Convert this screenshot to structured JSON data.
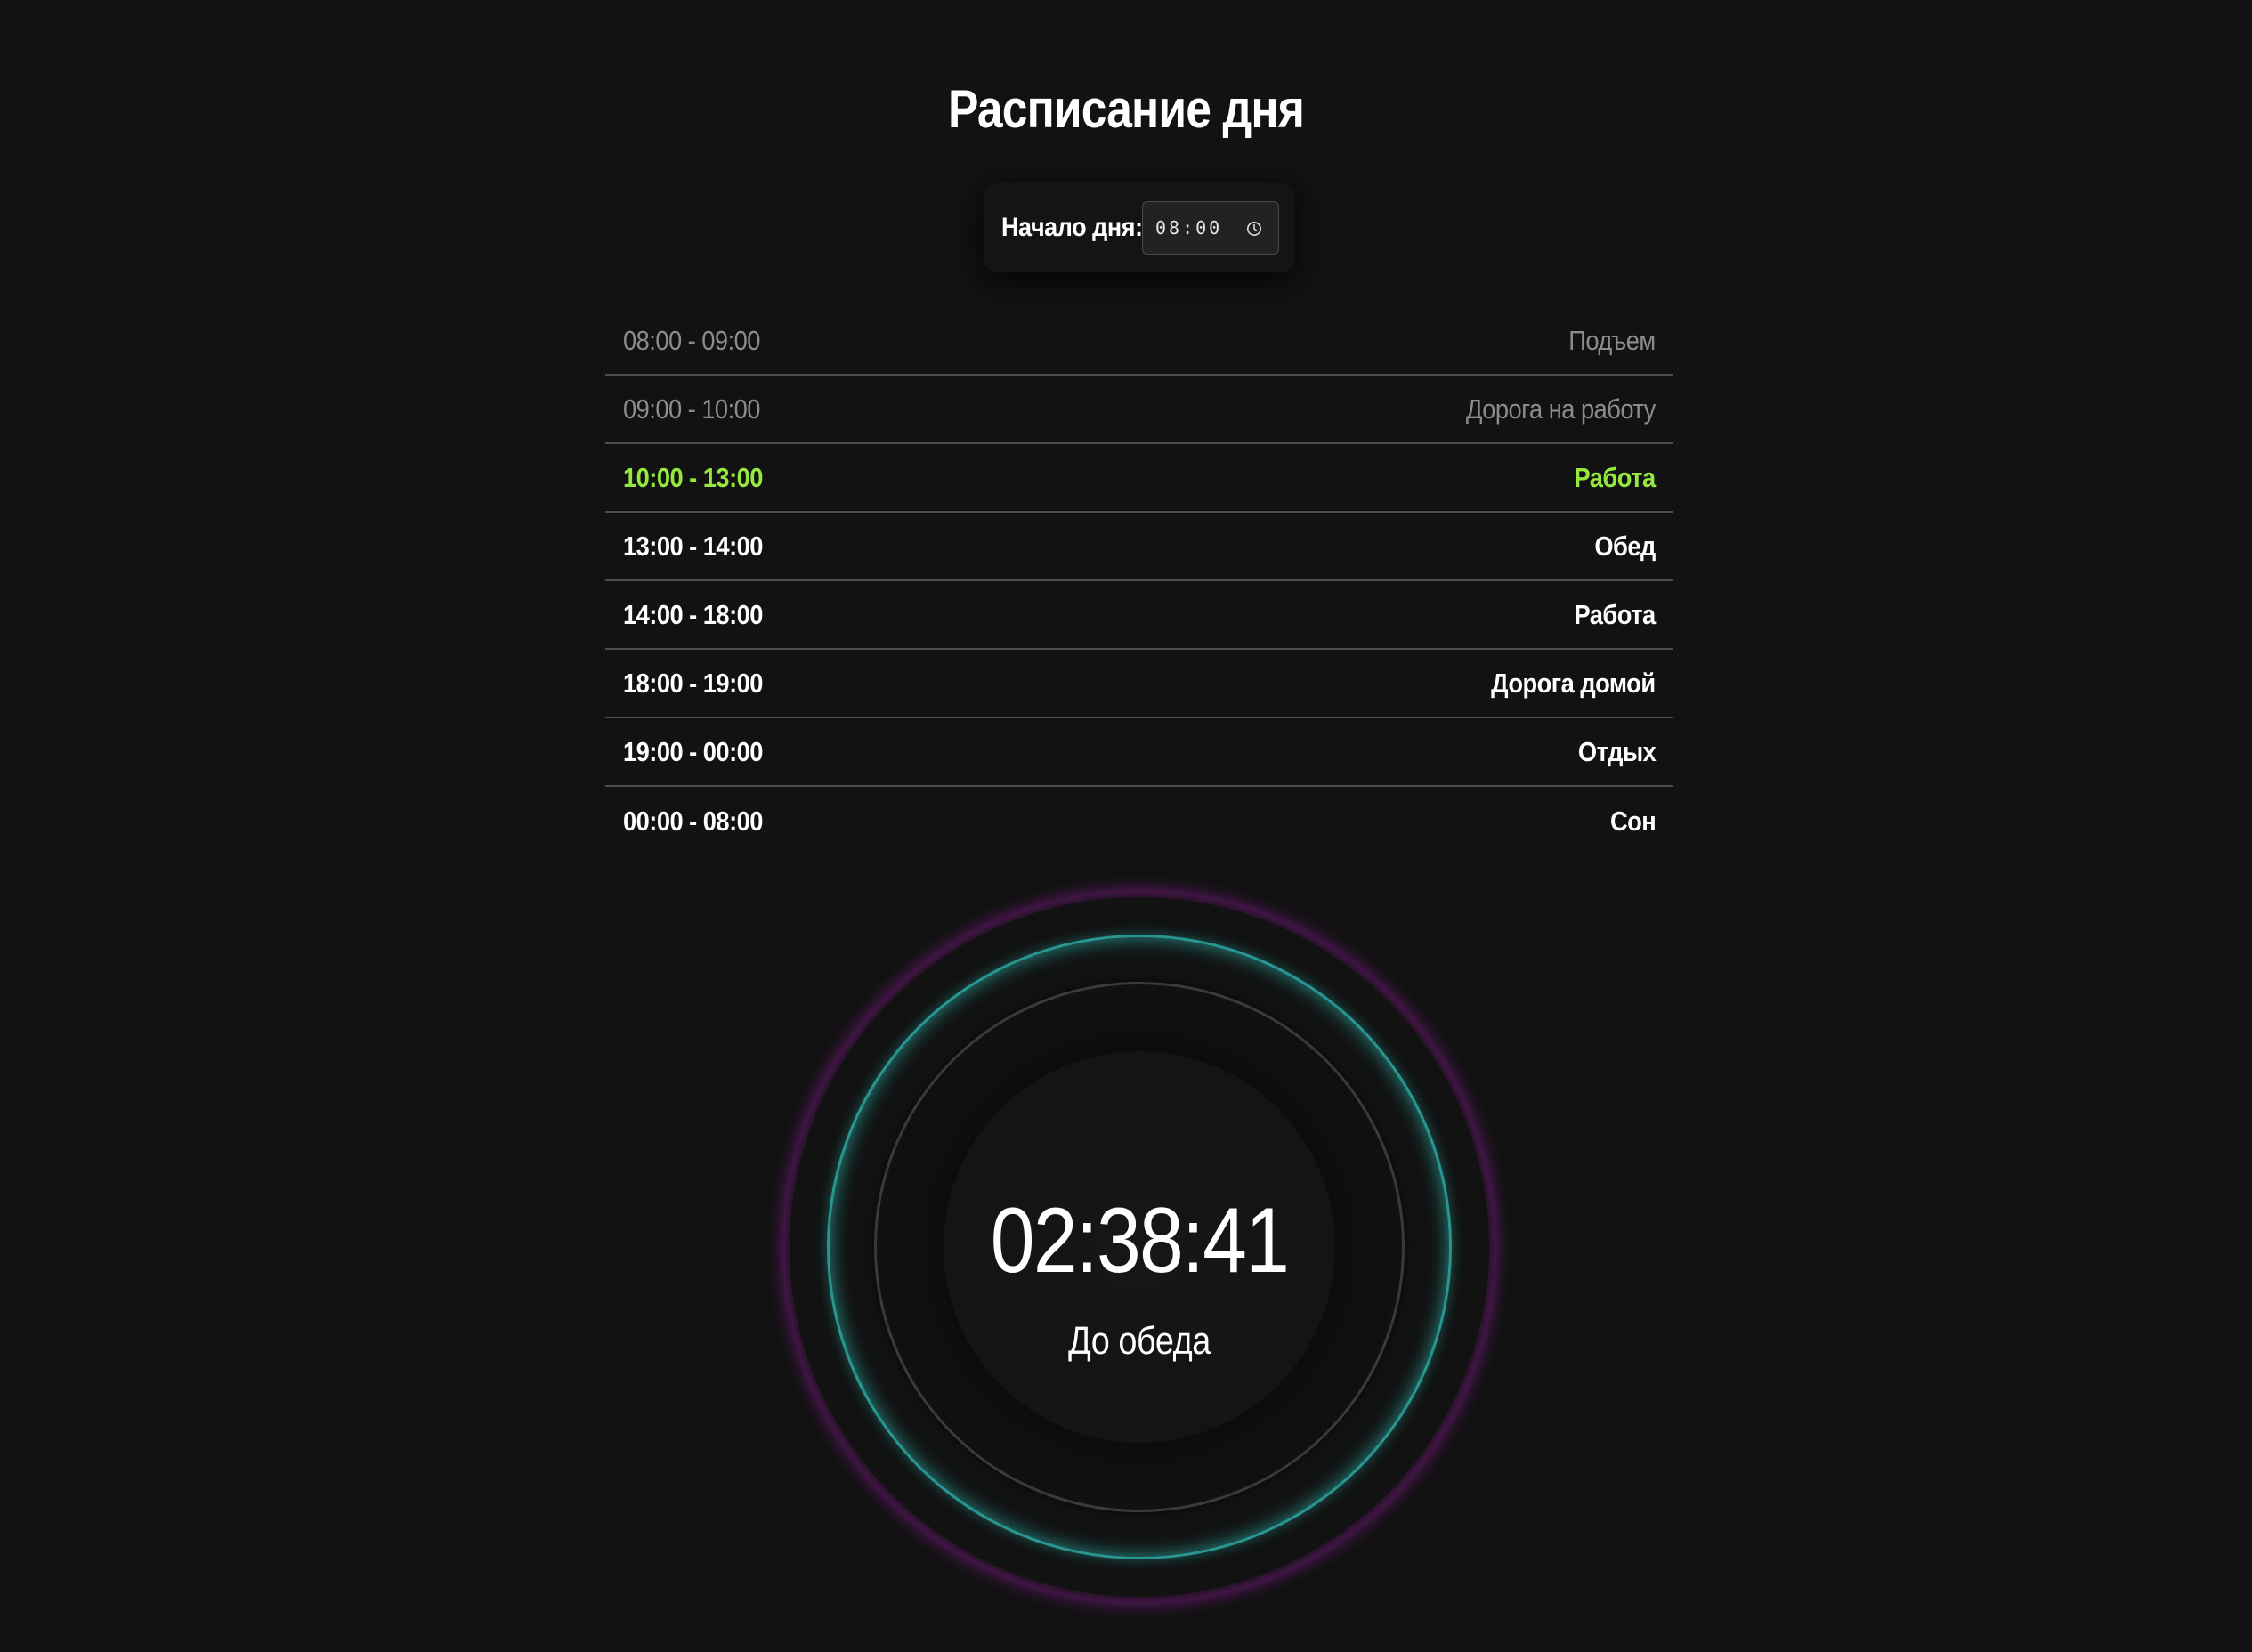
{
  "page": {
    "title": "Расписание дня"
  },
  "start": {
    "label": "Начало дня:",
    "value": "08:00",
    "icon": "clock-icon"
  },
  "schedule": [
    {
      "time": "08:00 - 09:00",
      "activity": "Подъем",
      "state": "past"
    },
    {
      "time": "09:00 - 10:00",
      "activity": "Дорога на работу",
      "state": "past"
    },
    {
      "time": "10:00 - 13:00",
      "activity": "Работа",
      "state": "current"
    },
    {
      "time": "13:00 - 14:00",
      "activity": "Обед",
      "state": "future"
    },
    {
      "time": "14:00 - 18:00",
      "activity": "Работа",
      "state": "future"
    },
    {
      "time": "18:00 - 19:00",
      "activity": "Дорога домой",
      "state": "future"
    },
    {
      "time": "19:00 - 00:00",
      "activity": "Отдых",
      "state": "future"
    },
    {
      "time": "00:00 - 08:00",
      "activity": "Сон",
      "state": "future"
    }
  ],
  "timer": {
    "countdown": "02:38:41",
    "label": "До обеда"
  },
  "colors": {
    "background": "#121212",
    "current": "#95e83c",
    "past": "#8c8c8c",
    "future": "#ffffff",
    "outer_ring": "#a81caf",
    "middle_ring": "#2da5a0",
    "inner_ring": "#3a3a3a"
  }
}
